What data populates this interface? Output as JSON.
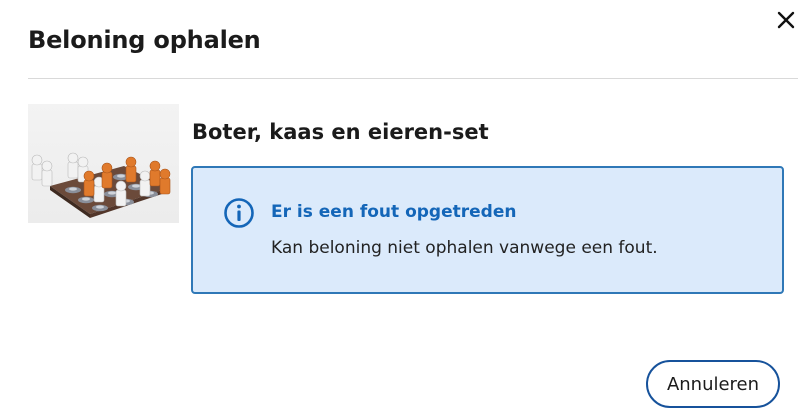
{
  "dialog": {
    "title": "Beloning ophalen",
    "close_icon": "close-icon"
  },
  "reward": {
    "product_name": "Boter, kaas en eieren-set",
    "image_icon": "product-image"
  },
  "alert": {
    "icon": "info-icon",
    "title": "Er is een fout opgetreden",
    "message": "Kan beloning niet ophalen vanwege een fout."
  },
  "actions": {
    "cancel_label": "Annuleren"
  },
  "colors": {
    "alert_bg": "#dbeafb",
    "alert_border": "#2f78b7",
    "alert_title": "#1466b8",
    "button_border": "#16529b"
  }
}
